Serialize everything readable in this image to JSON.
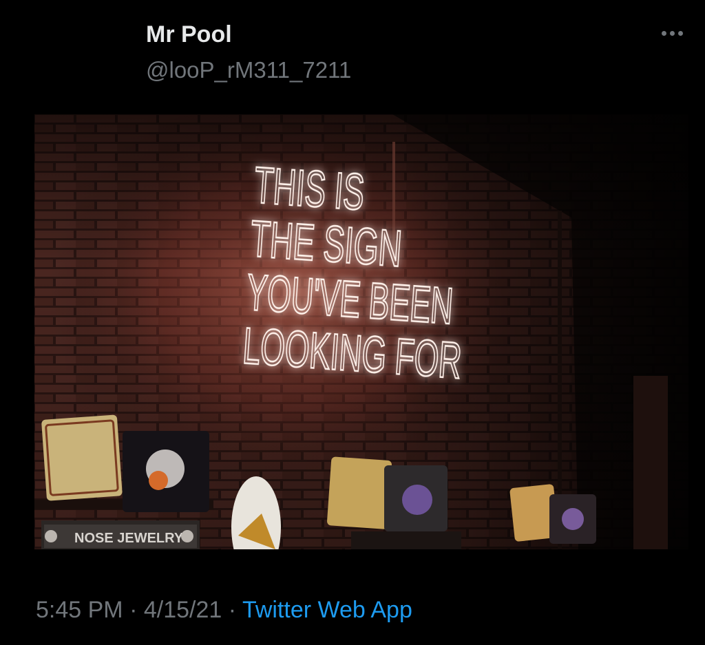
{
  "tweet": {
    "author_name": "Mr Pool",
    "author_handle": "@looP_rM311_7211",
    "more_icon": "more-horizontal-icon",
    "photo": {
      "neon_lines": [
        "THIS IS",
        "THE SIGN",
        "YOU'VE BEEN",
        "LOOKING FOR"
      ],
      "shelf_sign": "NOSE JEWELRY",
      "neon_color": "#fff1ea",
      "glow_color": "#ff6a55",
      "brick_color": "#4a2620"
    },
    "time": "5:45 PM",
    "separator": "·",
    "date": "4/15/21",
    "source": "Twitter Web App"
  },
  "colors": {
    "background": "#000000",
    "name_text": "#e7e9ea",
    "secondary_text": "#71767b",
    "link": "#1d9bf0"
  }
}
